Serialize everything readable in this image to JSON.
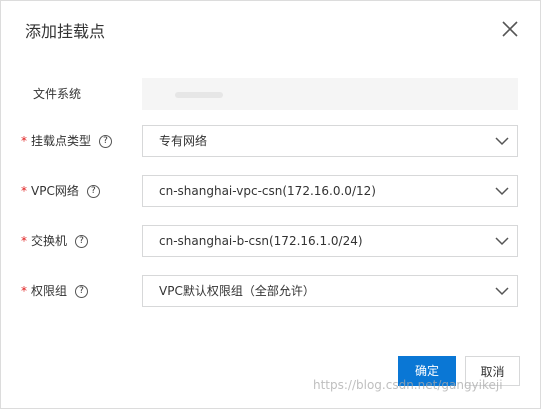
{
  "dialog": {
    "title": "添加挂载点",
    "close_icon": "close-icon"
  },
  "form": {
    "file_system": {
      "label": "文件系统",
      "required": false,
      "value": ""
    },
    "mount_type": {
      "label": "挂载点类型",
      "required": true,
      "value": "专有网络"
    },
    "vpc": {
      "label": "VPC网络",
      "required": true,
      "value": "cn-shanghai-vpc-csn(172.16.0.0/12)"
    },
    "vswitch": {
      "label": "交换机",
      "required": true,
      "value": "cn-shanghai-b-csn(172.16.1.0/24)"
    },
    "permission_group": {
      "label": "权限组",
      "required": true,
      "value": "VPC默认权限组（全部允许）"
    },
    "required_mark": "*",
    "help_glyph": "?"
  },
  "footer": {
    "confirm": "确定",
    "cancel": "取消"
  },
  "watermark": "https://blog.csdn.net/gangyikeji",
  "colors": {
    "primary": "#0a77d5",
    "required": "#e02020",
    "border": "#d7d8d9"
  }
}
